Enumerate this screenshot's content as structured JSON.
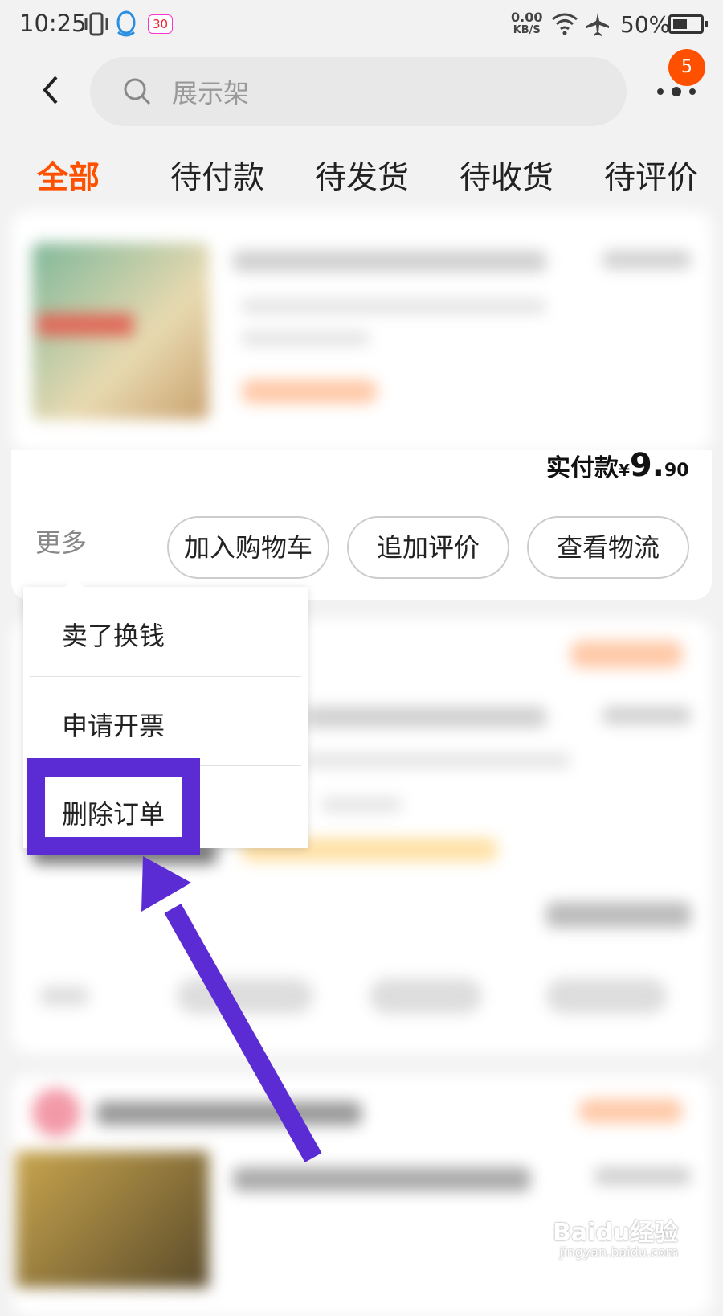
{
  "status_bar": {
    "time": "10:25",
    "notification_count": "30",
    "net_speed_value": "0.00",
    "net_speed_unit": "KB/S",
    "battery": "50%"
  },
  "header": {
    "search_placeholder": "展示架",
    "more_badge": "5"
  },
  "tabs": [
    {
      "label": "全部",
      "active": true
    },
    {
      "label": "待付款"
    },
    {
      "label": "待发货"
    },
    {
      "label": "待收货"
    },
    {
      "label": "待评价"
    }
  ],
  "order": {
    "paid_label": "实付款",
    "currency": "¥",
    "amount_int": "9.",
    "amount_dec": "90",
    "more_label": "更多",
    "buttons": [
      "加入购物车",
      "追加评价",
      "查看物流"
    ]
  },
  "more_menu": {
    "items": [
      "卖了换钱",
      "申请开票",
      "删除订单"
    ],
    "highlighted_index": 2
  },
  "watermark": {
    "brand": "Baidu经验",
    "url": "jingyan.baidu.com"
  },
  "colors": {
    "accent": "#ff5000",
    "annotation": "#5b2bd4"
  }
}
